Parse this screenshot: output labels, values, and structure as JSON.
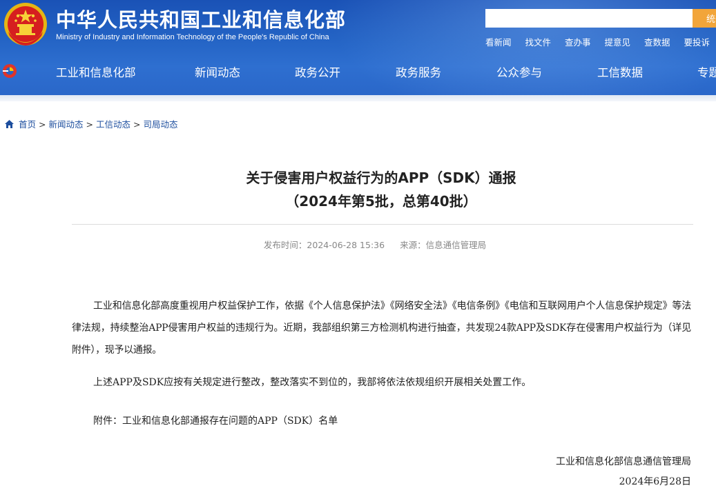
{
  "header": {
    "title_cn": "中华人民共和国工业和信息化部",
    "title_en": "Ministry of Industry and Information Technology of the People's Republic of China",
    "search": {
      "placeholder": "",
      "button_label": "统一"
    },
    "quick_links": [
      "看新闻",
      "找文件",
      "查办事",
      "提意见",
      "查数据",
      "要投诉"
    ],
    "colors": {
      "header_blue": "#2565c6",
      "search_button": "#f2a53a",
      "emblem_red": "#d61f1f",
      "emblem_gold": "#f3c316"
    }
  },
  "nav": {
    "items": [
      "工业和信息化部",
      "新闻动态",
      "政务公开",
      "政务服务",
      "公众参与",
      "工信数据",
      "专题"
    ]
  },
  "breadcrumb": {
    "items": [
      "首页",
      "新闻动态",
      "工信动态",
      "司局动态"
    ],
    "separator": ">"
  },
  "article": {
    "title_line1": "关于侵害用户权益行为的APP（SDK）通报",
    "title_line2": "（2024年第5批，总第40批）",
    "publish_time": "发布时间：2024-06-28 15:36",
    "source": "来源：信息通信管理局",
    "paragraphs": [
      "工业和信息化部高度重视用户权益保护工作，依据《个人信息保护法》《网络安全法》《电信条例》《电信和互联网用户个人信息保护规定》等法律法规，持续整治APP侵害用户权益的违规行为。近期，我部组织第三方检测机构进行抽查，共发现24款APP及SDK存在侵害用户权益行为（详见附件），现予以通报。",
      "上述APP及SDK应按有关规定进行整改，整改落实不到位的，我部将依法依规组织开展相关处置工作。",
      "附件：工业和信息化部通报存在问题的APP（SDK）名单"
    ],
    "signature_org": "工业和信息化部信息通信管理局",
    "signature_date": "2024年6月28日"
  }
}
